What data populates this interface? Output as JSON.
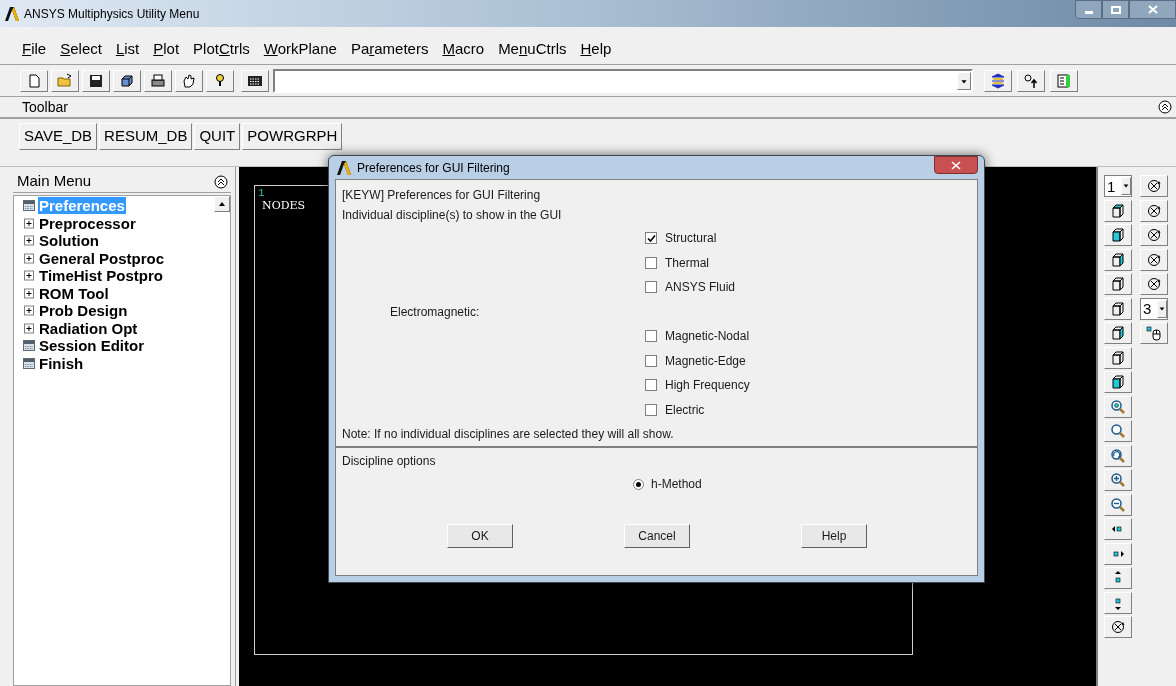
{
  "window": {
    "title": "ANSYS Multiphysics Utility Menu"
  },
  "menu_bar": [
    {
      "key": "F",
      "after": "ile"
    },
    {
      "key": "S",
      "after": "elect"
    },
    {
      "key": "L",
      "after": "ist"
    },
    {
      "key": "P",
      "after": "lot"
    },
    {
      "before": "Plot",
      "key": "C",
      "after": "trls"
    },
    {
      "key": "W",
      "after": "orkPlane"
    },
    {
      "before": "Pa",
      "key": "r",
      "after": "ameters"
    },
    {
      "key": "M",
      "after": "acro"
    },
    {
      "before": "Me",
      "key": "n",
      "after": "uCtrls"
    },
    {
      "key": "H",
      "after": "elp"
    }
  ],
  "toolbar": {
    "label": "Toolbar",
    "buttons": [
      "SAVE_DB",
      "RESUM_DB",
      "QUIT",
      "POWRGRPH"
    ]
  },
  "main_menu": {
    "title": "Main Menu",
    "items": [
      {
        "label": "Preferences",
        "kind": "leaf",
        "selected": true
      },
      {
        "label": "Preprocessor",
        "kind": "branch",
        "selected": false
      },
      {
        "label": "Solution",
        "kind": "branch",
        "selected": false
      },
      {
        "label": "General Postproc",
        "kind": "branch",
        "selected": false
      },
      {
        "label": "TimeHist Postpro",
        "kind": "branch",
        "selected": false
      },
      {
        "label": "ROM Tool",
        "kind": "branch",
        "selected": false
      },
      {
        "label": "Prob Design",
        "kind": "branch",
        "selected": false
      },
      {
        "label": "Radiation Opt",
        "kind": "branch",
        "selected": false
      },
      {
        "label": "Session Editor",
        "kind": "leaf",
        "selected": false
      },
      {
        "label": "Finish",
        "kind": "leaf",
        "selected": false
      }
    ]
  },
  "graphics": {
    "window_number": "1",
    "label": "NODES"
  },
  "view_toolbar": {
    "window_select": "1",
    "increment": "3"
  },
  "dialog": {
    "title": "Preferences for GUI Filtering",
    "heading": "[KEYW] Preferences for GUI Filtering",
    "subheading": "Individual discipline(s) to show in the GUI",
    "options": [
      {
        "kind": "checkbox",
        "label": "Structural",
        "checked": true
      },
      {
        "kind": "checkbox",
        "label": "Thermal",
        "checked": false
      },
      {
        "kind": "checkbox",
        "label": "ANSYS Fluid",
        "checked": false
      },
      {
        "kind": "group",
        "label": "Electromagnetic:"
      },
      {
        "kind": "checkbox",
        "label": "Magnetic-Nodal",
        "checked": false
      },
      {
        "kind": "checkbox",
        "label": "Magnetic-Edge",
        "checked": false
      },
      {
        "kind": "checkbox",
        "label": "High Frequency",
        "checked": false
      },
      {
        "kind": "checkbox",
        "label": "Electric",
        "checked": false
      }
    ],
    "note": "Note: If no individual disciplines are selected they will all show.",
    "options_heading": "Discipline options",
    "radios": [
      {
        "label": "h-Method",
        "selected": true
      }
    ],
    "buttons": [
      "OK",
      "Cancel",
      "Help"
    ]
  }
}
